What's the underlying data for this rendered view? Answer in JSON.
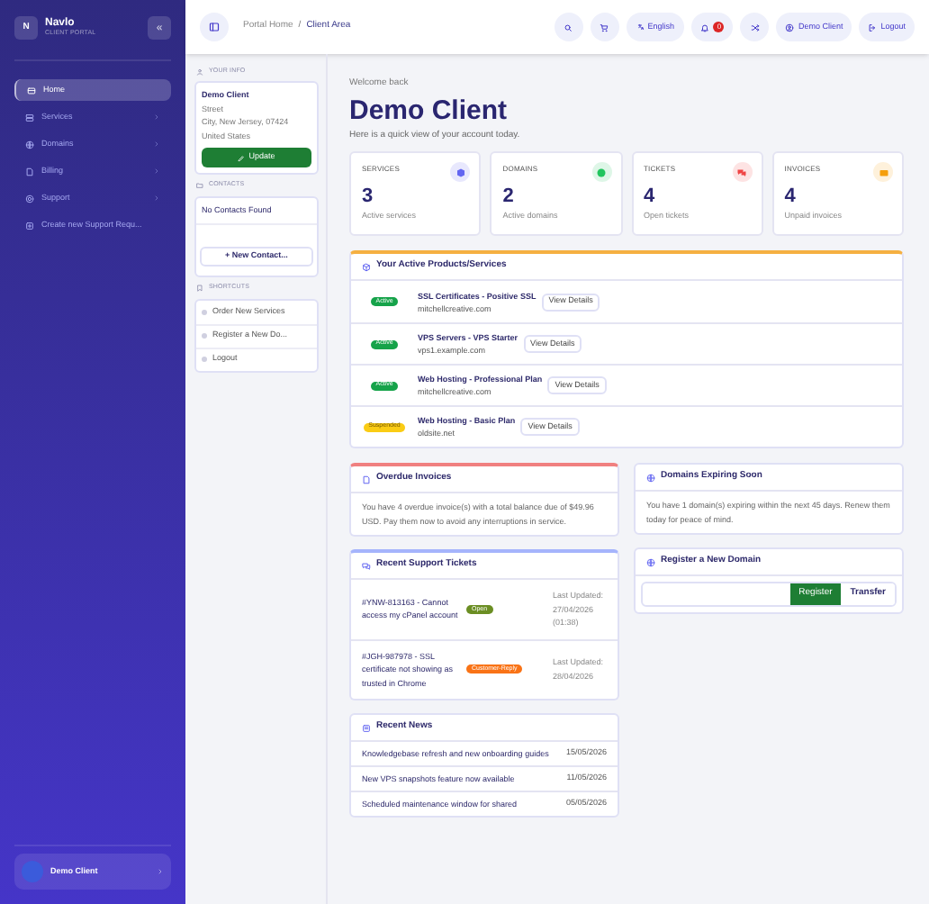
{
  "sidebar": {
    "brand": "Navlo",
    "logo_letter": "N",
    "subtitle": "CLIENT PORTAL",
    "collapse": "«",
    "items": [
      {
        "label": "Home",
        "selected": true,
        "has_children": false
      },
      {
        "label": "Services",
        "selected": false,
        "has_children": true
      },
      {
        "label": "Domains",
        "selected": false,
        "has_children": true
      },
      {
        "label": "Billing",
        "selected": false,
        "has_children": true
      },
      {
        "label": "Support",
        "selected": false,
        "has_children": true
      },
      {
        "label": "Create new Support Requ...",
        "selected": false,
        "has_children": false
      }
    ],
    "user": "Demo Client"
  },
  "breadcrumb": [
    "Portal Home",
    "Client Area"
  ],
  "breadcrumb_separator": "/",
  "topbar": {
    "language": "English",
    "notifications": "0",
    "user": "Demo Client",
    "logout": "Logout"
  },
  "left_panel": {
    "info_title": "YOUR INFO",
    "info_lines": [
      "Demo Client",
      "Street",
      "City, New Jersey, 07424",
      "United States"
    ],
    "update": "Update",
    "contacts_title": "CONTACTS",
    "contacts_empty": "No Contacts Found",
    "new_contact": "+ New Contact...",
    "shortcuts_title": "SHORTCUTS",
    "shortcuts": [
      "Order New Services",
      "Register a New Do...",
      "Logout"
    ]
  },
  "welcome": "Welcome back",
  "title": "Demo Client",
  "subtitle": "Here is a quick view of your account today.",
  "stats": [
    {
      "label": "SERVICES",
      "value": "3",
      "caption": "Active services",
      "color": "#6366f1"
    },
    {
      "label": "DOMAINS",
      "value": "2",
      "caption": "Active domains",
      "color": "#22c55e"
    },
    {
      "label": "TICKETS",
      "value": "4",
      "caption": "Open tickets",
      "color": "#ef4444"
    },
    {
      "label": "INVOICES",
      "value": "4",
      "caption": "Unpaid invoices",
      "color": "#f59e0b"
    }
  ],
  "products": {
    "title": "Your Active Products/Services",
    "rows": [
      {
        "status": "Active",
        "kind": "active",
        "name": "SSL Certificates - Positive SSL",
        "domain": "mitchellcreative.com",
        "action": "View Details"
      },
      {
        "status": "Active",
        "kind": "active",
        "name": "VPS Servers - VPS Starter",
        "domain": "vps1.example.com",
        "action": "View Details"
      },
      {
        "status": "Active",
        "kind": "active",
        "name": "Web Hosting - Professional Plan",
        "domain": "mitchellcreative.com",
        "action": "View Details"
      },
      {
        "status": "Suspended",
        "kind": "suspended",
        "name": "Web Hosting - Basic Plan",
        "domain": "oldsite.net",
        "action": "View Details"
      }
    ]
  },
  "overdue": {
    "title": "Overdue Invoices",
    "text": "You have 4 overdue invoice(s) with a total balance due of $49.96 USD. Pay them now to avoid any interruptions in service."
  },
  "tickets": {
    "title": "Recent Support Tickets",
    "rows": [
      {
        "subject": "#YNW-813163 - Cannot access my cPanel account",
        "status": "Open",
        "color": "#6b8e23",
        "updated": "Last Updated: 27/04/2026 (01:38)"
      },
      {
        "subject": "#JGH-987978 - SSL certificate not showing as trusted in Chrome",
        "status": "Customer-Reply",
        "color": "#f97316",
        "updated": "Last Updated: 28/04/2026"
      }
    ]
  },
  "news": {
    "title": "Recent News",
    "rows": [
      {
        "headline": "Knowledgebase refresh and new onboarding guides",
        "date": "15/05/2026"
      },
      {
        "headline": "New VPS snapshots feature now available",
        "date": "11/05/2026"
      },
      {
        "headline": "Scheduled maintenance window for shared",
        "date": "05/05/2026"
      }
    ]
  },
  "expiring": {
    "title": "Domains Expiring Soon",
    "text": "You have 1 domain(s) expiring within the next 45 days. Renew them today for peace of mind."
  },
  "register": {
    "title": "Register a New Domain",
    "register": "Register",
    "transfer": "Transfer"
  }
}
